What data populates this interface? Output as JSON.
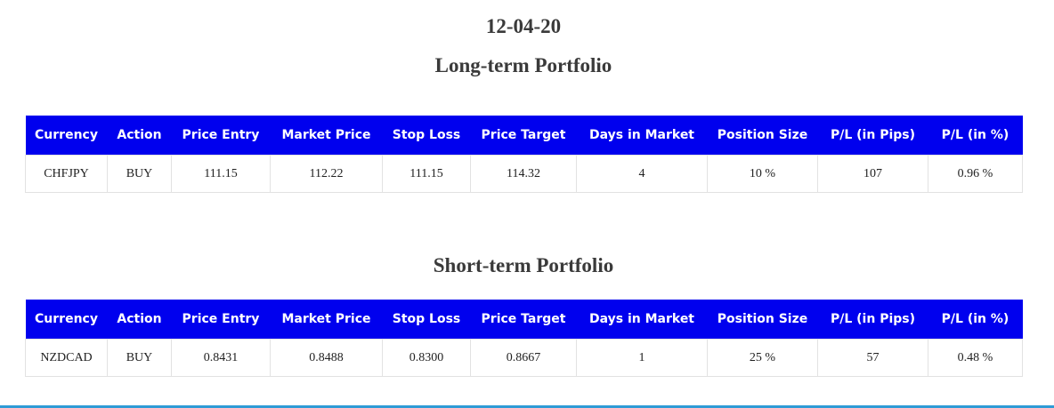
{
  "date": "12-04-20",
  "long_term": {
    "title": "Long-term Portfolio",
    "headers": [
      "Currency",
      "Action",
      "Price Entry",
      "Market Price",
      "Stop Loss",
      "Price Target",
      "Days in Market",
      "Position Size",
      "P/L (in Pips)",
      "P/L (in %)"
    ],
    "rows": [
      [
        "CHFJPY",
        "BUY",
        "111.15",
        "112.22",
        "111.15",
        "114.32",
        "4",
        "10 %",
        "107",
        "0.96 %"
      ]
    ]
  },
  "short_term": {
    "title": "Short-term Portfolio",
    "headers": [
      "Currency",
      "Action",
      "Price Entry",
      "Market Price",
      "Stop Loss",
      "Price Target",
      "Days in Market",
      "Position Size",
      "P/L (in Pips)",
      "P/L (in %)"
    ],
    "rows": [
      [
        "NZDCAD",
        "BUY",
        "0.8431",
        "0.8488",
        "0.8300",
        "0.8667",
        "1",
        "25 %",
        "57",
        "0.48 %"
      ]
    ]
  },
  "colors": {
    "header_bg": "#0000ee",
    "header_text": "#ffffff",
    "title_text": "#3a3a3a",
    "accent_line": "#2f9bd6"
  }
}
